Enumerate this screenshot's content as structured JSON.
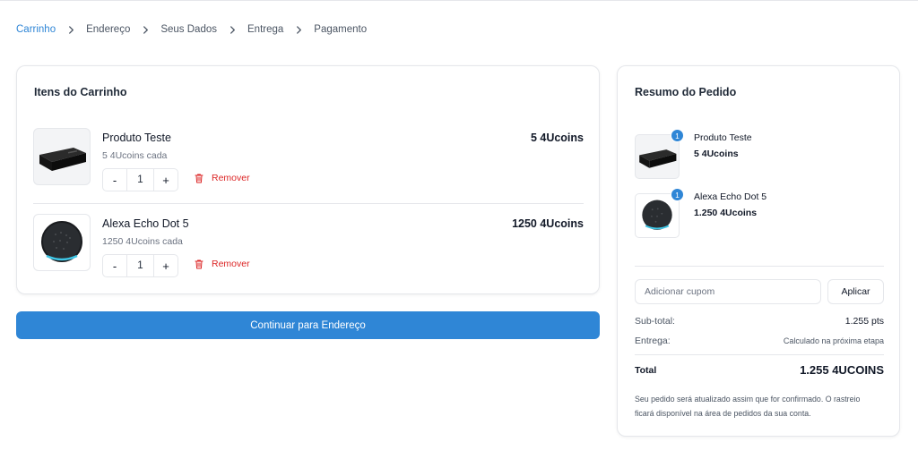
{
  "breadcrumb": {
    "steps": [
      "Carrinho",
      "Endereço",
      "Seus Dados",
      "Entrega",
      "Pagamento"
    ]
  },
  "cart": {
    "title": "Itens do Carrinho",
    "items": [
      {
        "name": "Produto Teste",
        "unit_price": "5 4Ucoins cada",
        "price": "5 4Ucoins",
        "quantity": "1",
        "remove_label": "Remover",
        "decrement": "-",
        "increment": "+"
      },
      {
        "name": "Alexa Echo Dot 5",
        "unit_price": "1250 4Ucoins cada",
        "price": "1250 4Ucoins",
        "quantity": "1",
        "remove_label": "Remover",
        "decrement": "-",
        "increment": "+"
      }
    ]
  },
  "continue_button": "Continuar para Endereço",
  "summary": {
    "title": "Resumo do Pedido",
    "items": [
      {
        "name": "Produto Teste",
        "price": "5 4Ucoins",
        "badge": "1"
      },
      {
        "name": "Alexa Echo Dot 5",
        "price": "1.250 4Ucoins",
        "badge": "1"
      }
    ],
    "coupon_placeholder": "Adicionar cupom",
    "apply_label": "Aplicar",
    "subtotal_label": "Sub-total:",
    "subtotal_value": "1.255 pts",
    "shipping_label": "Entrega:",
    "shipping_value": "Calculado na próxima etapa",
    "total_label": "Total",
    "total_value": "1.255 4UCOINS",
    "note": "Seu pedido será atualizado assim que for confirmado. O rastreio ficará disponível na área de pedidos da sua conta."
  },
  "colors": {
    "accent": "#2f86d6",
    "danger": "#dc2626",
    "border": "#e5e7eb"
  }
}
